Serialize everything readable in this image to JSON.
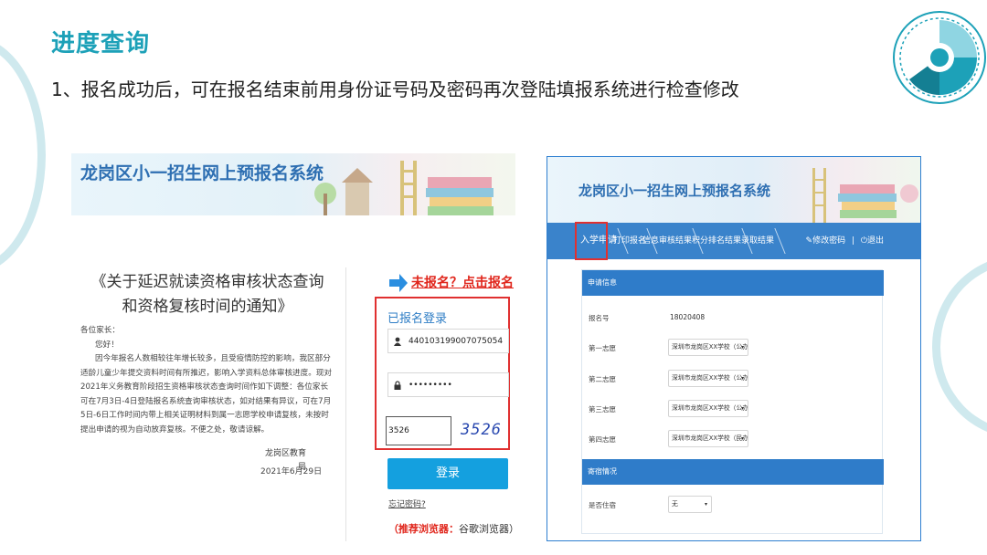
{
  "slide": {
    "title": "进度查询",
    "subtitle": "1、报名成功后，可在报名结束前用身份证号码及密码再次登陆填报系统进行检查修改"
  },
  "left_screen": {
    "site_title": "龙岗区小一招生网上预报名系统",
    "notice": {
      "title": "《关于延迟就读资格审核状态查询和资格复核时间的通知》",
      "salutation": "各位家长：",
      "greeting": "您好！",
      "body": "因今年报名人数相较往年增长较多，且受疫情防控的影响，我区部分适龄儿童少年提交资料时间有所推迟，影响入学资料总体审核进度。现对2021年义务教育阶段招生资格审核状态查询时间作如下调整：各位家长可在7月3日-4日登陆报名系统查询审核状态，如对结果有异议，可在7月5日-6日工作时间内带上相关证明材料到属一志愿学校申请复核，未按时提出申请的视为自动放弃复核。不便之处，敬请谅解。",
      "signature": "龙岗区教育局",
      "date": "2021年6月29日"
    },
    "register_link": "未报名？点击报名",
    "login": {
      "box_title": "已报名登录",
      "id_value": "440103199007075054",
      "password_mask": "•••••••••",
      "captcha_value": "3526",
      "captcha_image_text": "3526",
      "login_button": "登录",
      "forgot_password": "忘记密码?"
    },
    "browser_hint_red": "（推荐浏览器：",
    "browser_hint_name": "谷歌浏览器）"
  },
  "right_screen": {
    "site_title": "龙岗区小一招生网上预报名系统",
    "nav": {
      "items": [
        "入学申请",
        "打印报名",
        "信息审核结果",
        "积分排名结果",
        "录取结果"
      ],
      "change_password": "✎修改密码",
      "logout": "⏻退出",
      "separator": "|"
    },
    "sections": {
      "apply_info": "申请信息",
      "dormitory": "寄宿情况"
    },
    "fields": {
      "apply_no_label": "报名号",
      "apply_no_value": "18020408",
      "choice1_label": "第一志愿",
      "choice1_value": "深圳市龙岗区XX学校（公办）（小学部）",
      "choice2_label": "第二志愿",
      "choice2_value": "深圳市龙岗区XX学校（公办）（小学部）",
      "choice3_label": "第三志愿",
      "choice3_value": "深圳市龙岗区XX学校（公办）（小学部）",
      "choice4_label": "第四志愿",
      "choice4_value": "深圳市龙岗区XX学校（民办，普惠学...",
      "boarding_label": "是否住宿",
      "boarding_value": "无"
    }
  },
  "colors": {
    "accent": "#1da1b8",
    "red": "#e03030",
    "blue_nav": "#3a83cb",
    "blue_button": "#14a0df"
  }
}
